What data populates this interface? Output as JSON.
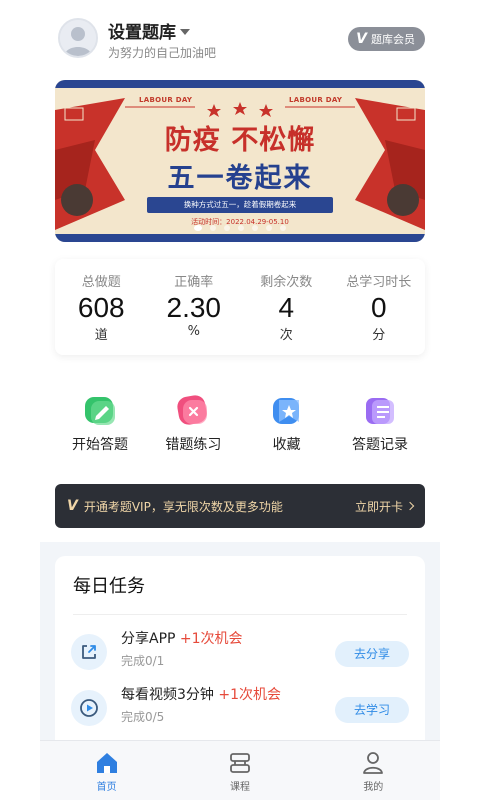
{
  "header": {
    "title": "设置题库",
    "subtitle": "为努力的自己加油吧",
    "member_badge": "题库会员"
  },
  "banner": {
    "label_left": "LABOUR DAY",
    "label_right": "LABOUR DAY",
    "line1": "防疫 不松懈",
    "line2": "五一卷起来",
    "pill": "换种方式过五一，趁着假期卷起来",
    "date": "活动时间：2022.04.29-05.10",
    "dots_total": 7,
    "dots_active": 1
  },
  "stats": [
    {
      "label": "总做题",
      "value": "608",
      "unit": "道"
    },
    {
      "label": "正确率",
      "value": "2.30",
      "unit": "%"
    },
    {
      "label": "剩余次数",
      "value": "4",
      "unit": "次"
    },
    {
      "label": "总学习时长",
      "value": "0",
      "unit": "分"
    }
  ],
  "actions": [
    {
      "label": "开始答题",
      "icon": "pencil-icon",
      "color": "#34c36b"
    },
    {
      "label": "错题练习",
      "icon": "wrong-icon",
      "color": "#f04f7e"
    },
    {
      "label": "收藏",
      "icon": "star-icon",
      "color": "#3f8ef0"
    },
    {
      "label": "答题记录",
      "icon": "record-icon",
      "color": "#9a6cf2"
    }
  ],
  "vip": {
    "mark": "V",
    "text": "开通考题VIP，享无限次数及更多功能",
    "cta": "立即开卡"
  },
  "tasks": {
    "title": "每日任务",
    "items": [
      {
        "title": "分享APP",
        "bonus": "+1次机会",
        "progress": "完成0/1",
        "button": "去分享",
        "icon": "share-icon"
      },
      {
        "title": "每看视频3分钟",
        "bonus": "+1次机会",
        "progress": "完成0/5",
        "button": "去学习",
        "icon": "play-icon"
      }
    ]
  },
  "tabbar": [
    {
      "label": "首页",
      "icon": "home-icon",
      "active": true
    },
    {
      "label": "课程",
      "icon": "course-icon",
      "active": false
    },
    {
      "label": "我的",
      "icon": "profile-icon",
      "active": false
    }
  ],
  "colors": {
    "accent": "#2f7fe0",
    "bonus": "#e64a3b",
    "vip_bg": "#2c2f36",
    "vip_text": "#f0d6a8"
  }
}
